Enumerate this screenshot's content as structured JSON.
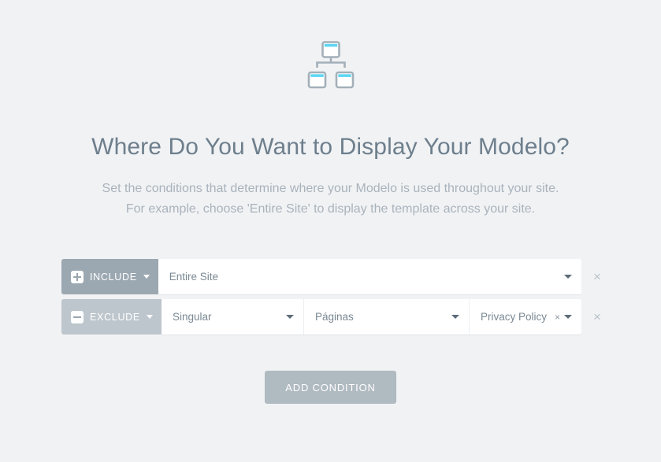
{
  "icon": {
    "name": "sitemap-icon",
    "accent_color": "#5ed6f2",
    "outline_color": "#a3b0b9"
  },
  "heading": {
    "title": "Where Do You Want to Display Your Modelo?",
    "subtitle_line1": "Set the conditions that determine where your Modelo is used throughout your site.",
    "subtitle_line2": "For example, choose 'Entire Site' to display the template across your site."
  },
  "colors": {
    "background": "#f1f2f4",
    "include_button": "#9ca8b1",
    "exclude_button": "#bec6cd",
    "add_button": "#b0bac1",
    "title_text": "#6d7f8d",
    "subtitle_text": "#a9b3bc",
    "field_text": "#7a8893"
  },
  "conditions": [
    {
      "type_label": "INCLUDE",
      "sign": "plus",
      "remove_label": "×",
      "fields": [
        {
          "name": "target-select",
          "value": "Entire Site",
          "has_caret": true,
          "has_clear": false
        }
      ]
    },
    {
      "type_label": "EXCLUDE",
      "sign": "minus",
      "remove_label": "×",
      "fields": [
        {
          "name": "scope-select",
          "value": "Singular",
          "has_caret": true,
          "has_clear": false
        },
        {
          "name": "post-type-select",
          "value": "Páginas",
          "has_caret": true,
          "has_clear": false
        },
        {
          "name": "specific-page-select",
          "value": "Privacy Policy",
          "has_caret": true,
          "has_clear": true,
          "clear_label": "×"
        }
      ]
    }
  ],
  "add_button": {
    "label": "ADD CONDITION"
  }
}
